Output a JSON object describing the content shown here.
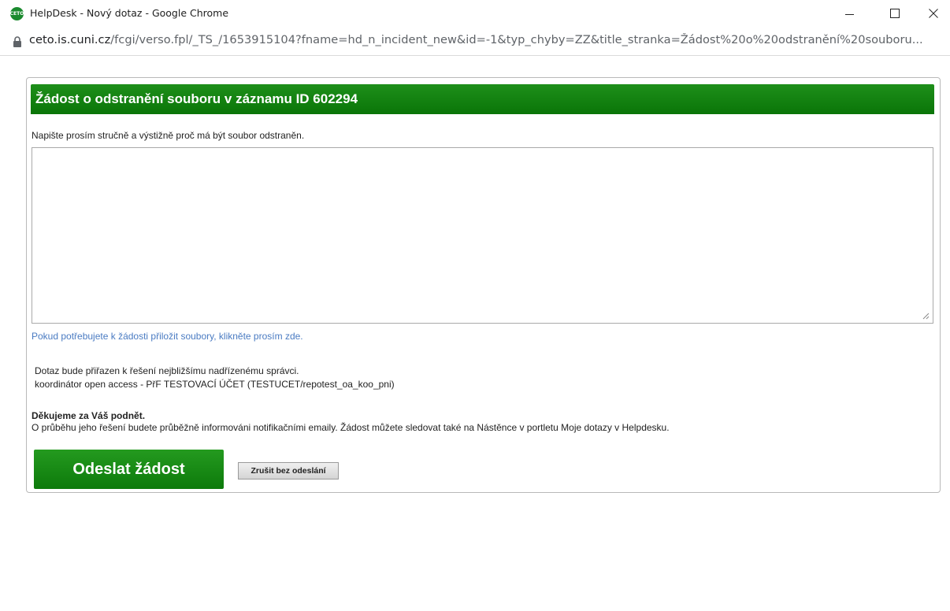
{
  "window": {
    "title": "HelpDesk - Nový dotaz - Google Chrome",
    "logo_text": "CETO",
    "controls": {
      "minimize": "–",
      "maximize": "☐",
      "close": "✕"
    }
  },
  "address_bar": {
    "host": "ceto.is.cuni.cz",
    "path": "/fcgi/verso.fpl/_TS_/1653915104?fname=hd_n_incident_new&id=-1&typ_chyby=ZZ&title_stranka=Žádost%20o%20odstranění%20souboru..."
  },
  "form": {
    "header_title": "Žádost o odstranění souboru v záznamu ID 602294",
    "instruction": "Napište prosím stručně a výstižně proč má být soubor odstraněn.",
    "textarea_value": "",
    "attach_link": "Pokud potřebujete k žádosti přiložit soubory, klikněte prosím zde.",
    "assignment_line1": "Dotaz bude přiřazen k řešení nejbližšímu nadřízenému správci.",
    "assignment_line2": "koordinátor open access - PřF TESTOVACÍ ÚČET (TESTUCET/repotest_oa_koo_pni)",
    "thanks_title": "Děkujeme za Váš podnět.",
    "thanks_text": "O průběhu jeho řešení budete průběžně informováni notifikačními emaily. Žádost můžete sledovat také na Nástěnce v portletu Moje dotazy v Helpdesku.",
    "submit_label": "Odeslat žádost",
    "cancel_label": "Zrušit bez odeslání"
  },
  "colors": {
    "header_green": "#12851a",
    "link_blue": "#4a7bc2"
  }
}
